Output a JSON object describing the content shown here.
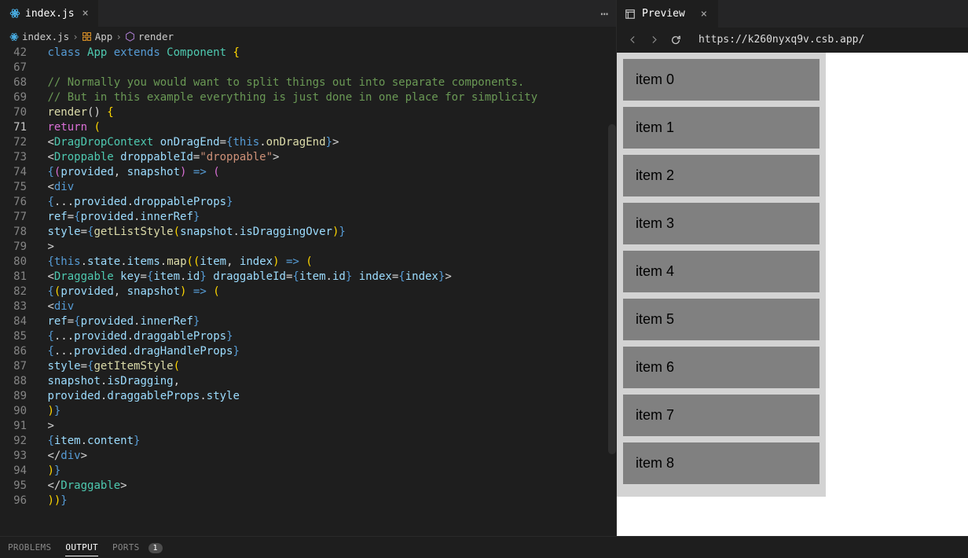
{
  "tabs": {
    "file": "index.js"
  },
  "breadcrumbs": {
    "file": "index.js",
    "class": "App",
    "method": "render"
  },
  "code": {
    "lines": [
      {
        "num": "42",
        "tokens": [
          [
            "    ",
            ""
          ],
          [
            "class ",
            "tk-kw"
          ],
          [
            "App",
            "tk-cls"
          ],
          [
            " extends ",
            "tk-kw"
          ],
          [
            "Component ",
            "tk-cls"
          ],
          [
            "{",
            "tk-brk"
          ]
        ]
      },
      {
        "num": "67",
        "tokens": []
      },
      {
        "num": "68",
        "tokens": [
          [
            "      ",
            ""
          ],
          [
            "// Normally you would want to split things out into separate components.",
            "tk-cmt"
          ]
        ]
      },
      {
        "num": "69",
        "tokens": [
          [
            "      ",
            ""
          ],
          [
            "// But in this example everything is just done in one place for simplicity",
            "tk-cmt"
          ]
        ]
      },
      {
        "num": "70",
        "tokens": [
          [
            "      ",
            ""
          ],
          [
            "render",
            "tk-fn"
          ],
          [
            "()",
            "tk-pun"
          ],
          [
            " {",
            "tk-brk"
          ]
        ]
      },
      {
        "num": "71",
        "tokens": [
          [
            "        ",
            ""
          ],
          [
            "return ",
            "tk-purple"
          ],
          [
            "(",
            "tk-brk"
          ]
        ],
        "active": true
      },
      {
        "num": "72",
        "tokens": [
          [
            "          ",
            ""
          ],
          [
            "<",
            "tk-pun"
          ],
          [
            "DragDropContext",
            "tk-tag"
          ],
          [
            " onDragEnd",
            "tk-attr"
          ],
          [
            "=",
            "tk-pun"
          ],
          [
            "{",
            "tk-kw"
          ],
          [
            "this",
            "tk-kw"
          ],
          [
            ".",
            "tk-pun"
          ],
          [
            "onDragEnd",
            "tk-fn"
          ],
          [
            "}",
            "tk-kw"
          ],
          [
            ">",
            "tk-pun"
          ]
        ]
      },
      {
        "num": "73",
        "tokens": [
          [
            "            ",
            ""
          ],
          [
            "<",
            "tk-pun"
          ],
          [
            "Droppable",
            "tk-tag"
          ],
          [
            " droppableId",
            "tk-attr"
          ],
          [
            "=",
            "tk-pun"
          ],
          [
            "\"droppable\"",
            "tk-str"
          ],
          [
            ">",
            "tk-pun"
          ]
        ]
      },
      {
        "num": "74",
        "tokens": [
          [
            "              ",
            ""
          ],
          [
            "{",
            "tk-kw"
          ],
          [
            "(",
            "tk-purple"
          ],
          [
            "provided",
            "tk-var"
          ],
          [
            ", ",
            "tk-pun"
          ],
          [
            "snapshot",
            "tk-var"
          ],
          [
            ")",
            "tk-purple"
          ],
          [
            " => ",
            "tk-kw"
          ],
          [
            "(",
            "tk-purple"
          ]
        ]
      },
      {
        "num": "75",
        "tokens": [
          [
            "                ",
            ""
          ],
          [
            "<",
            "tk-pun"
          ],
          [
            "div",
            "tk-kw"
          ]
        ]
      },
      {
        "num": "76",
        "tokens": [
          [
            "                  ",
            ""
          ],
          [
            "{",
            "tk-kw"
          ],
          [
            "...",
            "tk-pun"
          ],
          [
            "provided",
            "tk-var"
          ],
          [
            ".",
            "tk-pun"
          ],
          [
            "droppableProps",
            "tk-var"
          ],
          [
            "}",
            "tk-kw"
          ]
        ]
      },
      {
        "num": "77",
        "tokens": [
          [
            "                  ",
            ""
          ],
          [
            "ref",
            "tk-attr"
          ],
          [
            "=",
            "tk-pun"
          ],
          [
            "{",
            "tk-kw"
          ],
          [
            "provided",
            "tk-var"
          ],
          [
            ".",
            "tk-pun"
          ],
          [
            "innerRef",
            "tk-var"
          ],
          [
            "}",
            "tk-kw"
          ]
        ]
      },
      {
        "num": "78",
        "tokens": [
          [
            "                  ",
            ""
          ],
          [
            "style",
            "tk-attr"
          ],
          [
            "=",
            "tk-pun"
          ],
          [
            "{",
            "tk-kw"
          ],
          [
            "getListStyle",
            "tk-fn"
          ],
          [
            "(",
            "tk-brk"
          ],
          [
            "snapshot",
            "tk-var"
          ],
          [
            ".",
            "tk-pun"
          ],
          [
            "isDraggingOver",
            "tk-var"
          ],
          [
            ")",
            "tk-brk"
          ],
          [
            "}",
            "tk-kw"
          ]
        ]
      },
      {
        "num": "79",
        "tokens": [
          [
            "                ",
            ""
          ],
          [
            ">",
            "tk-pun"
          ]
        ]
      },
      {
        "num": "80",
        "tokens": [
          [
            "                  ",
            ""
          ],
          [
            "{",
            "tk-kw"
          ],
          [
            "this",
            "tk-kw"
          ],
          [
            ".",
            "tk-pun"
          ],
          [
            "state",
            "tk-var"
          ],
          [
            ".",
            "tk-pun"
          ],
          [
            "items",
            "tk-var"
          ],
          [
            ".",
            "tk-pun"
          ],
          [
            "map",
            "tk-fn"
          ],
          [
            "((",
            "tk-brk"
          ],
          [
            "item",
            "tk-var"
          ],
          [
            ", ",
            "tk-pun"
          ],
          [
            "index",
            "tk-var"
          ],
          [
            ")",
            "tk-brk"
          ],
          [
            " => ",
            "tk-kw"
          ],
          [
            "(",
            "tk-brk"
          ]
        ]
      },
      {
        "num": "81",
        "tokens": [
          [
            "                    ",
            ""
          ],
          [
            "<",
            "tk-pun"
          ],
          [
            "Draggable",
            "tk-tag"
          ],
          [
            " key",
            "tk-attr"
          ],
          [
            "=",
            "tk-pun"
          ],
          [
            "{",
            "tk-kw"
          ],
          [
            "item",
            "tk-var"
          ],
          [
            ".",
            "tk-pun"
          ],
          [
            "id",
            "tk-var"
          ],
          [
            "}",
            "tk-kw"
          ],
          [
            " draggableId",
            "tk-attr"
          ],
          [
            "=",
            "tk-pun"
          ],
          [
            "{",
            "tk-kw"
          ],
          [
            "item",
            "tk-var"
          ],
          [
            ".",
            "tk-pun"
          ],
          [
            "id",
            "tk-var"
          ],
          [
            "}",
            "tk-kw"
          ],
          [
            " index",
            "tk-attr"
          ],
          [
            "=",
            "tk-pun"
          ],
          [
            "{",
            "tk-kw"
          ],
          [
            "index",
            "tk-var"
          ],
          [
            "}",
            "tk-kw"
          ],
          [
            ">",
            "tk-pun"
          ]
        ]
      },
      {
        "num": "82",
        "tokens": [
          [
            "                      ",
            ""
          ],
          [
            "{",
            "tk-kw"
          ],
          [
            "(",
            "tk-brk"
          ],
          [
            "provided",
            "tk-var"
          ],
          [
            ", ",
            "tk-pun"
          ],
          [
            "snapshot",
            "tk-var"
          ],
          [
            ")",
            "tk-brk"
          ],
          [
            " => ",
            "tk-kw"
          ],
          [
            "(",
            "tk-brk"
          ]
        ]
      },
      {
        "num": "83",
        "tokens": [
          [
            "                        ",
            ""
          ],
          [
            "<",
            "tk-pun"
          ],
          [
            "div",
            "tk-kw"
          ]
        ]
      },
      {
        "num": "84",
        "tokens": [
          [
            "                          ",
            ""
          ],
          [
            "ref",
            "tk-attr"
          ],
          [
            "=",
            "tk-pun"
          ],
          [
            "{",
            "tk-kw"
          ],
          [
            "provided",
            "tk-var"
          ],
          [
            ".",
            "tk-pun"
          ],
          [
            "innerRef",
            "tk-var"
          ],
          [
            "}",
            "tk-kw"
          ]
        ]
      },
      {
        "num": "85",
        "tokens": [
          [
            "                          ",
            ""
          ],
          [
            "{",
            "tk-kw"
          ],
          [
            "...",
            "tk-pun"
          ],
          [
            "provided",
            "tk-var"
          ],
          [
            ".",
            "tk-pun"
          ],
          [
            "draggableProps",
            "tk-var"
          ],
          [
            "}",
            "tk-kw"
          ]
        ]
      },
      {
        "num": "86",
        "tokens": [
          [
            "                          ",
            ""
          ],
          [
            "{",
            "tk-kw"
          ],
          [
            "...",
            "tk-pun"
          ],
          [
            "provided",
            "tk-var"
          ],
          [
            ".",
            "tk-pun"
          ],
          [
            "dragHandleProps",
            "tk-var"
          ],
          [
            "}",
            "tk-kw"
          ]
        ]
      },
      {
        "num": "87",
        "tokens": [
          [
            "                          ",
            ""
          ],
          [
            "style",
            "tk-attr"
          ],
          [
            "=",
            "tk-pun"
          ],
          [
            "{",
            "tk-kw"
          ],
          [
            "getItemStyle",
            "tk-fn"
          ],
          [
            "(",
            "tk-brk"
          ]
        ]
      },
      {
        "num": "88",
        "tokens": [
          [
            "                            ",
            ""
          ],
          [
            "snapshot",
            "tk-var"
          ],
          [
            ".",
            "tk-pun"
          ],
          [
            "isDragging",
            "tk-var"
          ],
          [
            ",",
            "tk-pun"
          ]
        ]
      },
      {
        "num": "89",
        "tokens": [
          [
            "                            ",
            ""
          ],
          [
            "provided",
            "tk-var"
          ],
          [
            ".",
            "tk-pun"
          ],
          [
            "draggableProps",
            "tk-var"
          ],
          [
            ".",
            "tk-pun"
          ],
          [
            "style",
            "tk-var"
          ]
        ]
      },
      {
        "num": "90",
        "tokens": [
          [
            "                          ",
            ""
          ],
          [
            ")",
            "tk-brk"
          ],
          [
            "}",
            "tk-kw"
          ]
        ]
      },
      {
        "num": "91",
        "tokens": [
          [
            "                        ",
            ""
          ],
          [
            ">",
            "tk-pun"
          ]
        ]
      },
      {
        "num": "92",
        "tokens": [
          [
            "                          ",
            ""
          ],
          [
            "{",
            "tk-kw"
          ],
          [
            "item",
            "tk-var"
          ],
          [
            ".",
            "tk-pun"
          ],
          [
            "content",
            "tk-var"
          ],
          [
            "}",
            "tk-kw"
          ]
        ]
      },
      {
        "num": "93",
        "tokens": [
          [
            "                        ",
            ""
          ],
          [
            "</",
            "tk-pun"
          ],
          [
            "div",
            "tk-kw"
          ],
          [
            ">",
            "tk-pun"
          ]
        ]
      },
      {
        "num": "94",
        "tokens": [
          [
            "                      ",
            ""
          ],
          [
            ")",
            "tk-brk"
          ],
          [
            "}",
            "tk-kw"
          ]
        ]
      },
      {
        "num": "95",
        "tokens": [
          [
            "                    ",
            ""
          ],
          [
            "</",
            "tk-pun"
          ],
          [
            "Draggable",
            "tk-tag"
          ],
          [
            ">",
            "tk-pun"
          ]
        ]
      },
      {
        "num": "96",
        "tokens": [
          [
            "                  ",
            ""
          ],
          [
            "))",
            "tk-brk"
          ],
          [
            "}",
            "tk-kw"
          ]
        ]
      }
    ]
  },
  "preview": {
    "label": "Preview",
    "url": "https://k260nyxq9v.csb.app/",
    "items": [
      "item 0",
      "item 1",
      "item 2",
      "item 3",
      "item 4",
      "item 5",
      "item 6",
      "item 7",
      "item 8"
    ]
  },
  "bottom": {
    "problems": "PROBLEMS",
    "output": "OUTPUT",
    "ports": "PORTS",
    "ports_count": "1"
  }
}
